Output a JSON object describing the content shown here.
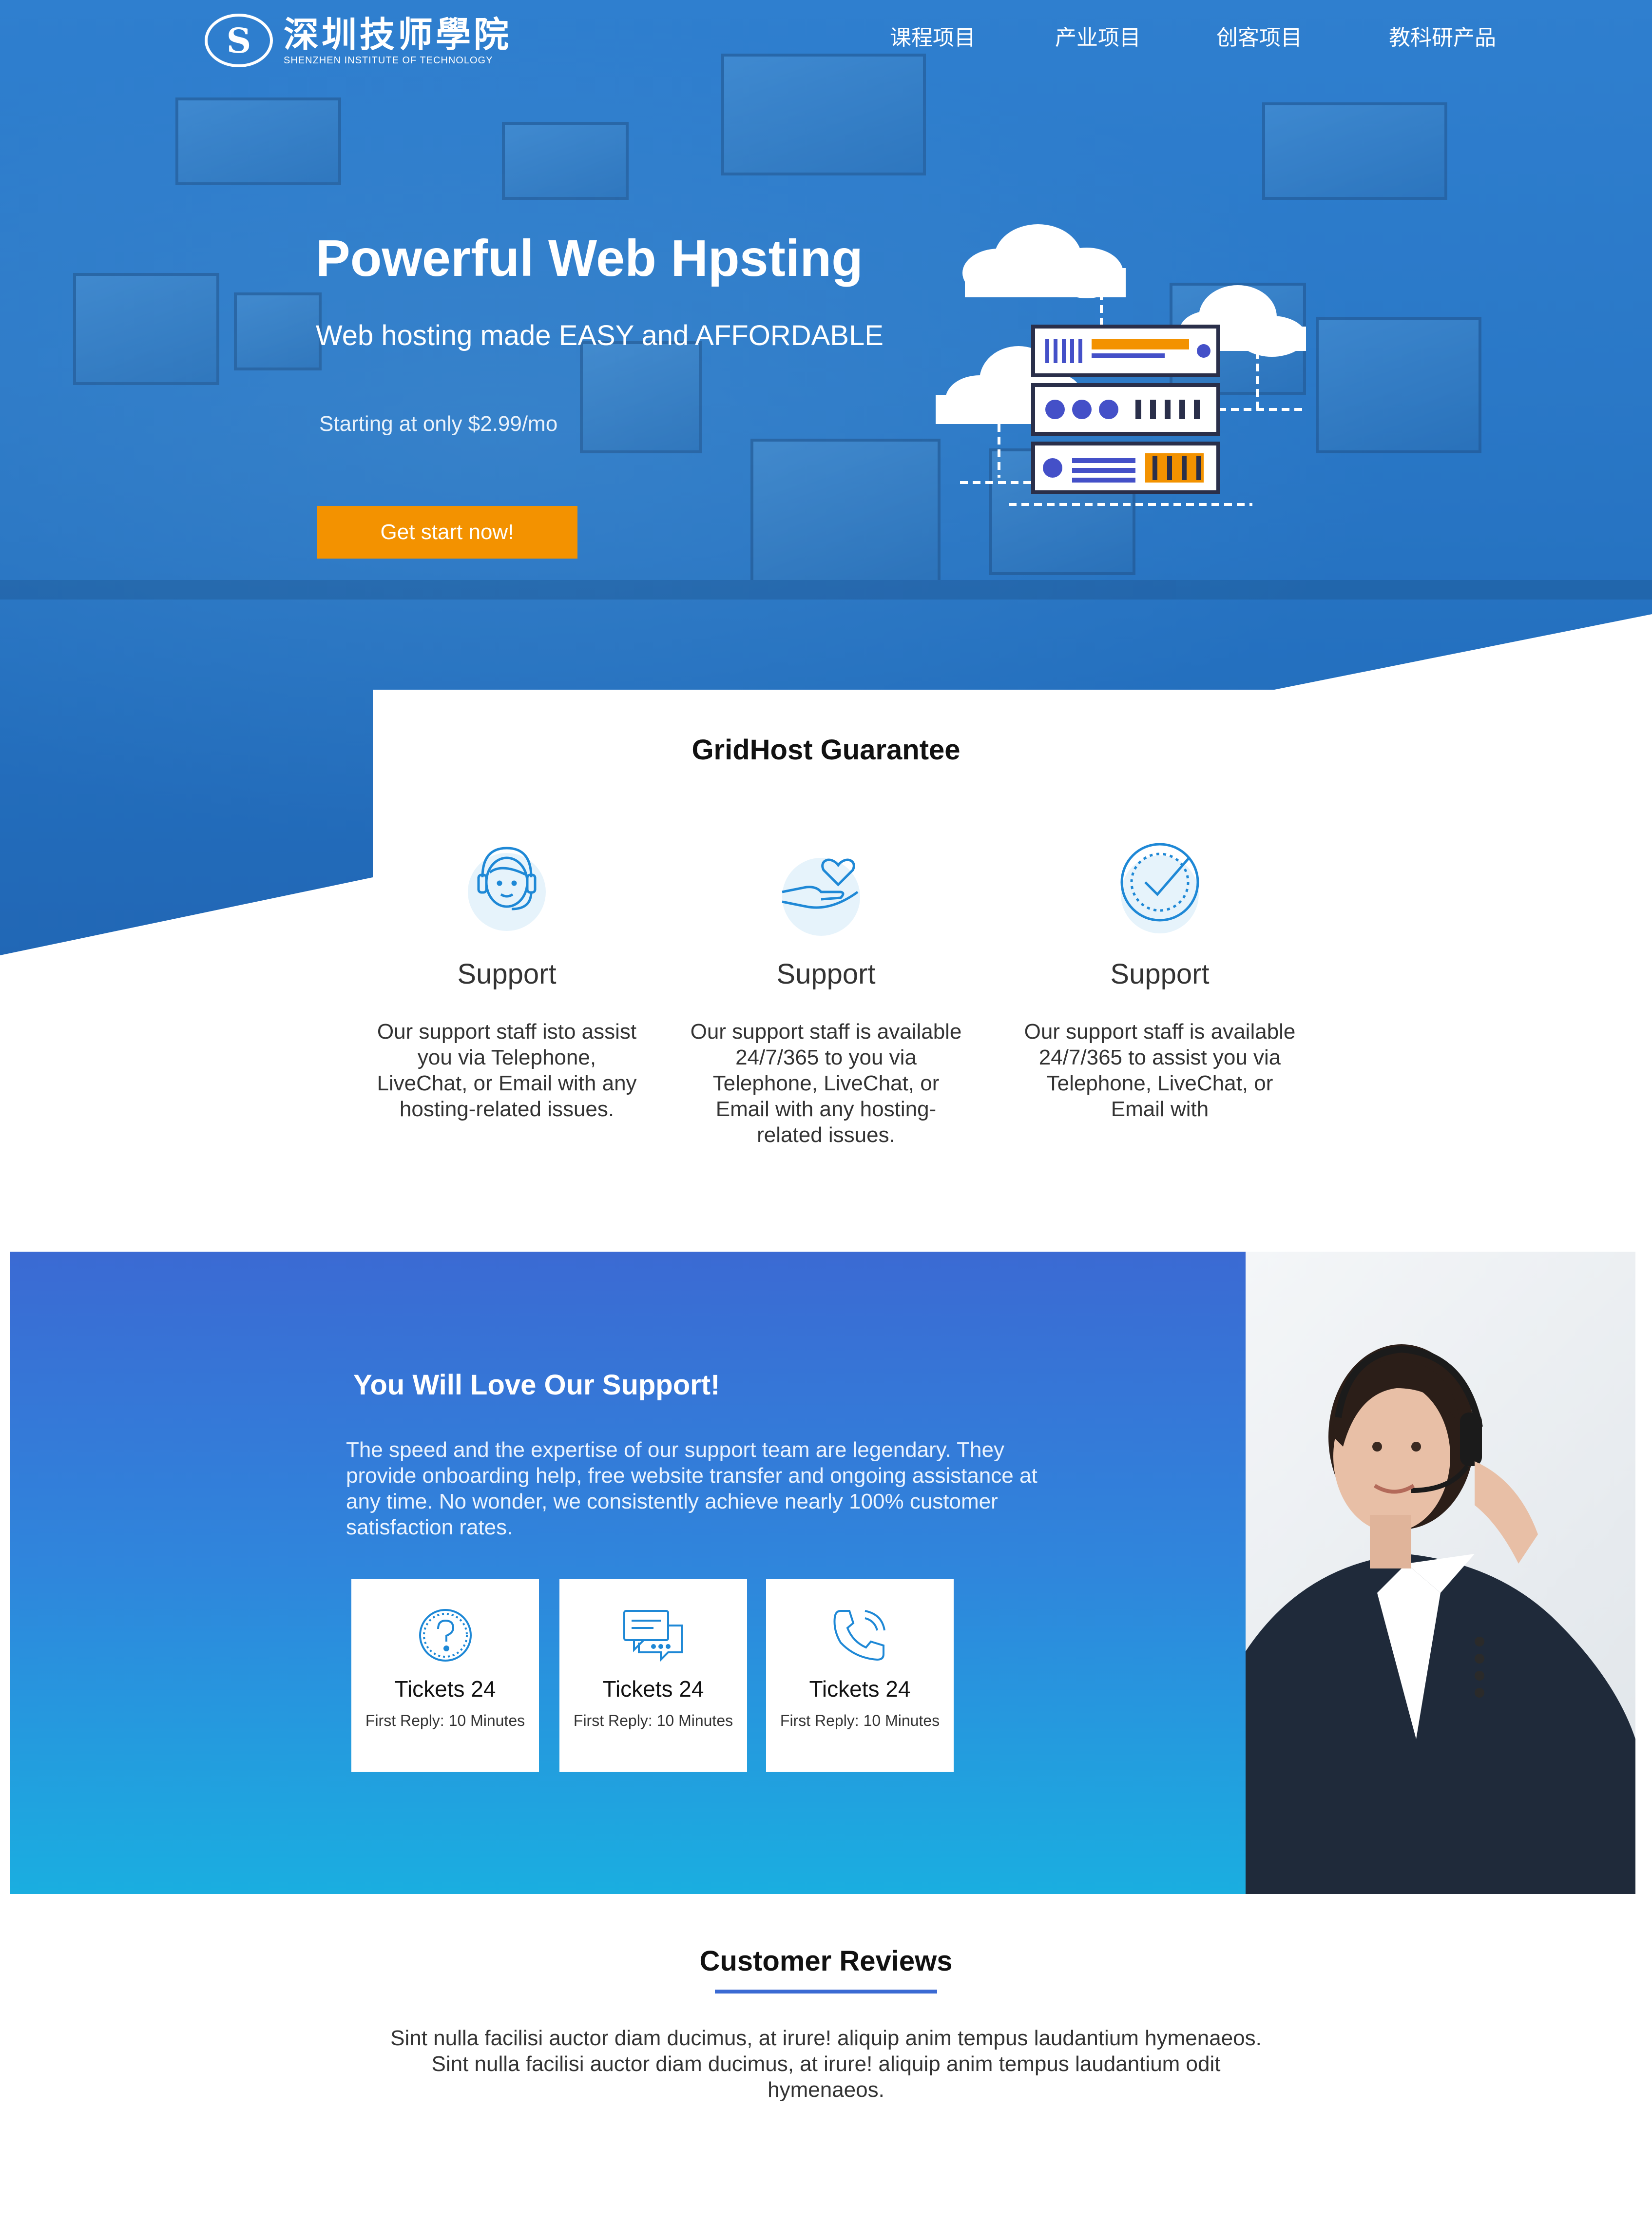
{
  "header": {
    "logo_cn": "深圳技师學院",
    "logo_en": "SHENZHEN INSTITUTE OF TECHNOLOGY",
    "logo_mark": "S",
    "nav": [
      {
        "label": "课程项目"
      },
      {
        "label": "产业项目"
      },
      {
        "label": "创客项目"
      },
      {
        "label": "教科研产品"
      }
    ]
  },
  "hero": {
    "title": "Powerful Web Hpsting",
    "subtitle": "Web hosting made EASY and AFFORDABLE",
    "price": "Starting at only $2.99/mo",
    "cta": "Get start now!"
  },
  "guarantee": {
    "title": "GridHost Guarantee",
    "features": [
      {
        "icon": "support-agent-icon",
        "title": "Support",
        "text": "Our support staff isto assist you via Telephone, LiveChat, or Email with any hosting-related issues."
      },
      {
        "icon": "heart-hand-icon",
        "title": "Support",
        "text": "Our support staff is available 24/7/365 to you via Telephone, LiveChat, or Email with any hosting-related issues."
      },
      {
        "icon": "check-circle-icon",
        "title": "Support",
        "text": "Our support staff is available 24/7/365 to assist you via Telephone, LiveChat, or Email with"
      }
    ]
  },
  "support": {
    "title": "You Will Love Our Support!",
    "text": "The speed and the expertise of our support team are legendary. They provide onboarding help, free website transfer and ongoing assistance at any time. No wonder, we consistently achieve nearly 100% customer satisfaction rates.",
    "tickets": [
      {
        "icon": "question-icon",
        "title": "Tickets 24",
        "sub": "First Reply: 10 Minutes"
      },
      {
        "icon": "chat-icon",
        "title": "Tickets 24",
        "sub": "First Reply: 10 Minutes"
      },
      {
        "icon": "phone-icon",
        "title": "Tickets 24",
        "sub": "First Reply: 10 Minutes"
      }
    ]
  },
  "reviews": {
    "title": "Customer Reviews",
    "text": "Sint nulla facilisi auctor diam ducimus, at irure! aliquip anim tempus laudantium hymenaeos. Sint nulla facilisi auctor diam ducimus, at irure! aliquip anim tempus laudantium odit hymenaeos."
  },
  "colors": {
    "hero_blue": "#2a78c7",
    "cta_orange": "#f39200",
    "support_gradient_top": "#3b6ad3",
    "support_gradient_bottom": "#1aaee0",
    "icon_blue": "#1e88d6",
    "icon_bg": "#e6f3fb"
  }
}
